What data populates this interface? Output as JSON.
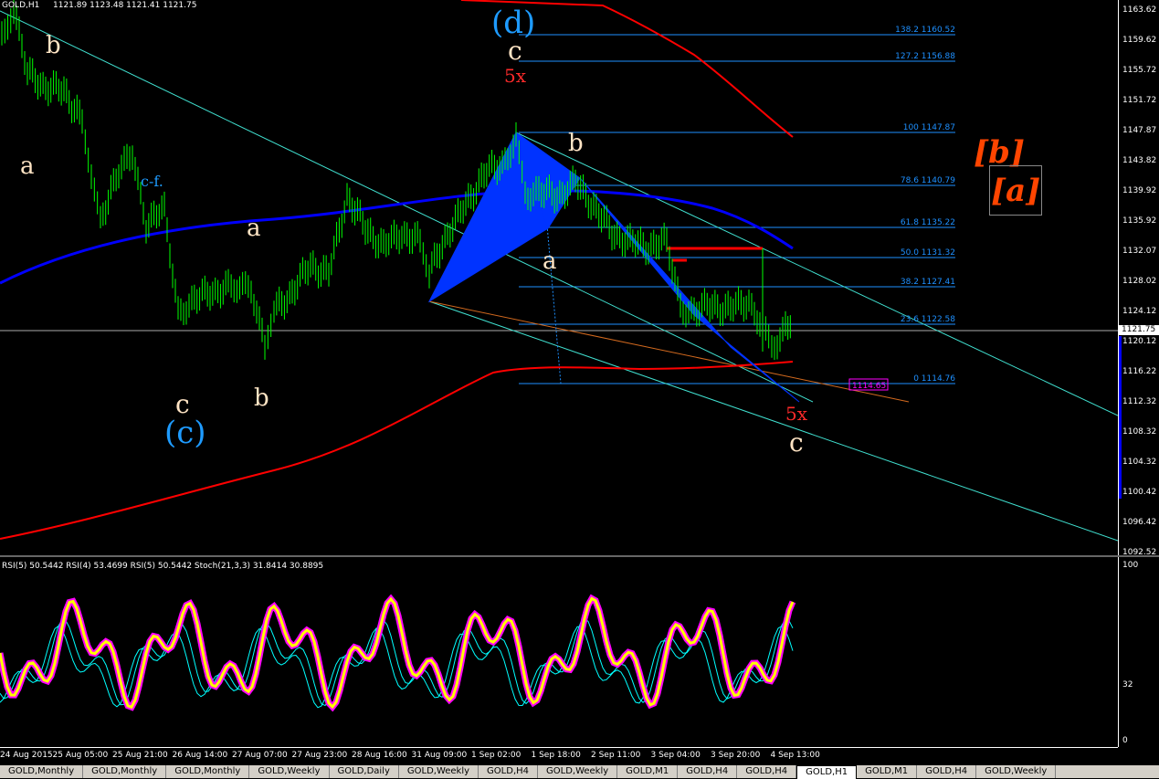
{
  "header": {
    "symbol_info": "GOLD,H1",
    "ohlc": "1121.89 1123.48 1121.41 1121.75"
  },
  "price_axis": [
    "1163.62",
    "1159.62",
    "1155.72",
    "1151.72",
    "1147.87",
    "1143.82",
    "1139.92",
    "1135.92",
    "1132.07",
    "1128.02",
    "1124.12",
    "1120.12",
    "1116.22",
    "1112.32",
    "1108.32",
    "1104.32",
    "1100.42",
    "1096.42",
    "1092.52"
  ],
  "current_price": "1121.75",
  "fib_levels": [
    {
      "label": "138.2 1160.52"
    },
    {
      "label": "127.2 1156.88"
    },
    {
      "label": "100 1147.87"
    },
    {
      "label": "78.6 1140.79"
    },
    {
      "label": "61.8 1135.22"
    },
    {
      "label": "50.0 1131.32"
    },
    {
      "label": "38.2 1127.41"
    },
    {
      "label": "23.6 1122.58"
    },
    {
      "label": "0 1114.76"
    }
  ],
  "price_box": "1114.65",
  "indicator": {
    "header": "RSI(5) 50.5442  RSI(4) 53.4699  RSI(5) 50.5442  Stoch(21,3,3) 31.8414 30.8895",
    "axis": [
      "100",
      "32",
      "0"
    ]
  },
  "time_axis": [
    "24 Aug 2015",
    "25 Aug 05:00",
    "25 Aug 21:00",
    "26 Aug 14:00",
    "27 Aug 07:00",
    "27 Aug 23:00",
    "28 Aug 16:00",
    "31 Aug 09:00",
    "1 Sep 02:00",
    "1 Sep 18:00",
    "2 Sep 11:00",
    "3 Sep 04:00",
    "3 Sep 20:00",
    "4 Sep 13:00"
  ],
  "wave_labels": {
    "d_paren": "(d)",
    "c_paren": "(c)",
    "b_bracket": "[b]",
    "a_bracket": "[a]",
    "five_x": "5x",
    "five_x_2": "5x",
    "c_big_1": "c",
    "c_big_2": "c",
    "c_big_3": "c",
    "a_big_1": "a",
    "a_big_2": "a",
    "a_big_3": "a",
    "b_big_1": "b",
    "b_big_2": "b",
    "b_big_3": "b",
    "c_f": "c-f."
  },
  "tabs": [
    {
      "label": "GOLD,Monthly",
      "active": false
    },
    {
      "label": "GOLD,Monthly",
      "active": false
    },
    {
      "label": "GOLD,Monthly",
      "active": false
    },
    {
      "label": "GOLD,Weekly",
      "active": false
    },
    {
      "label": "GOLD,Daily",
      "active": false
    },
    {
      "label": "GOLD,Weekly",
      "active": false
    },
    {
      "label": "GOLD,H4",
      "active": false
    },
    {
      "label": "GOLD,Weekly",
      "active": false
    },
    {
      "label": "GOLD,M1",
      "active": false
    },
    {
      "label": "GOLD,H4",
      "active": false
    },
    {
      "label": "GOLD,H4",
      "active": false
    },
    {
      "label": "GOLD,H1",
      "active": true
    },
    {
      "label": "GOLD,M1",
      "active": false
    },
    {
      "label": "GOLD,H4",
      "active": false
    },
    {
      "label": "GOLD,Weekly",
      "active": false
    }
  ],
  "colors": {
    "candle": "#00ff00",
    "ma_blue": "#0000ff",
    "ma_red": "#ff0000",
    "trend": "#40e0d0",
    "fib": "#1e90ff",
    "rsi_thick": "#ffff00",
    "rsi_magenta": "#ff00ff",
    "stoch": "#00ffff"
  }
}
